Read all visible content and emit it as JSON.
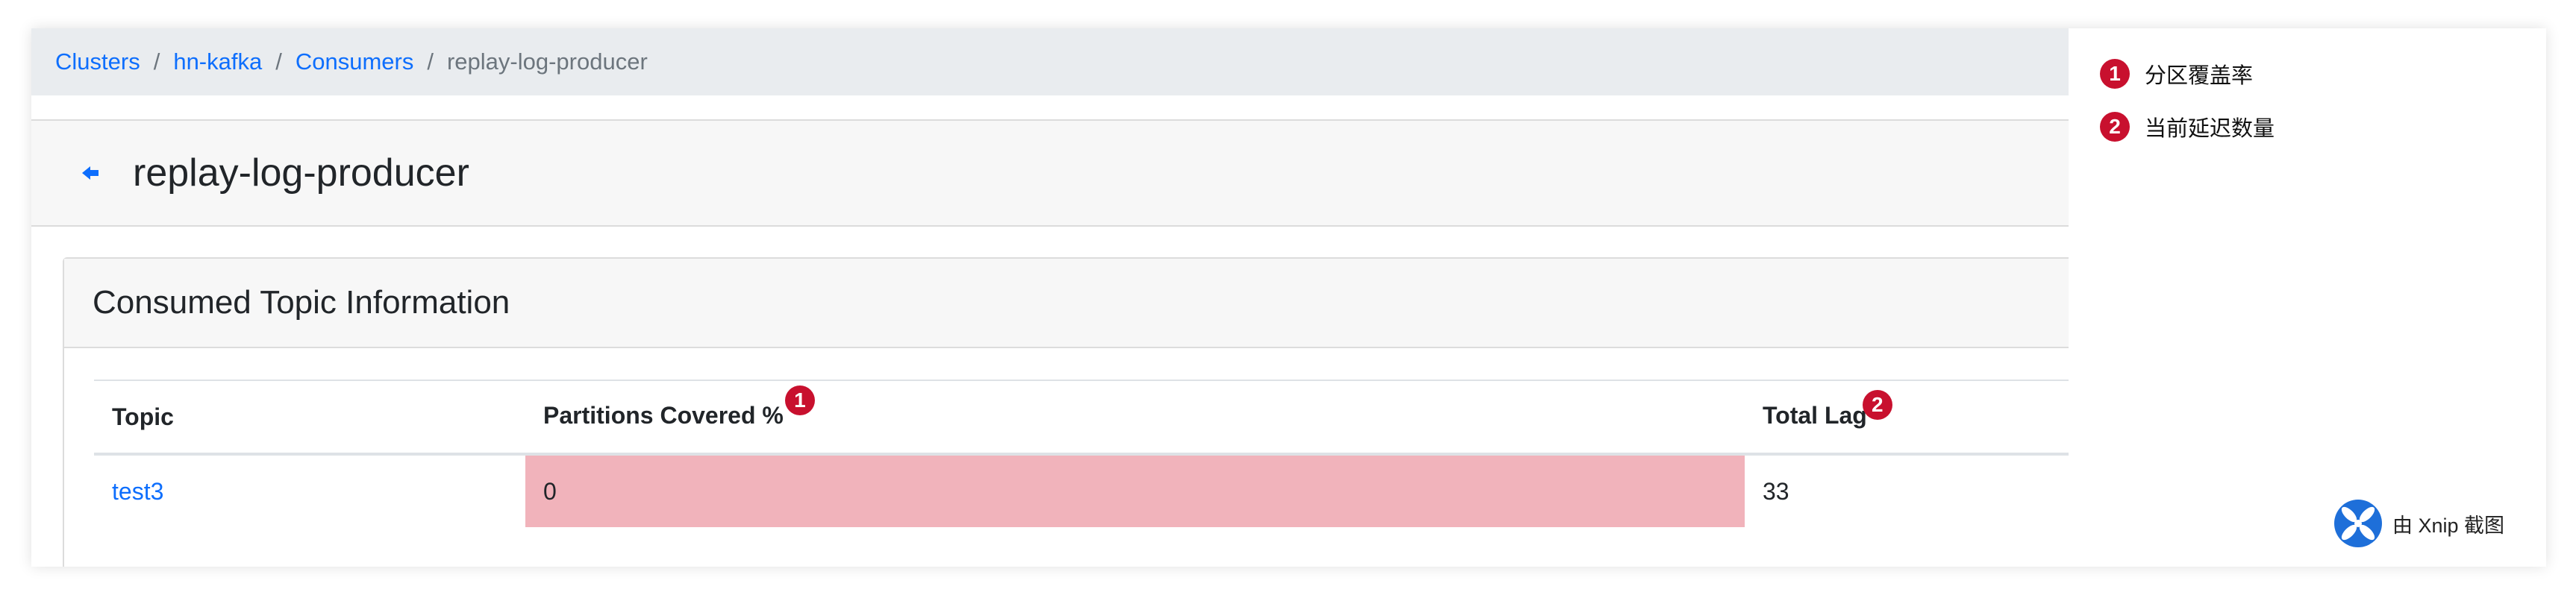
{
  "breadcrumb": {
    "items": [
      "Clusters",
      "hn-kafka",
      "Consumers"
    ],
    "current": "replay-log-producer",
    "separator": "/"
  },
  "page": {
    "title": "replay-log-producer"
  },
  "section": {
    "title": "Consumed Topic Information"
  },
  "table": {
    "headers": {
      "topic": "Topic",
      "partitions": "Partitions Covered %",
      "partitions_marker": "1",
      "lag": "Total Lag",
      "lag_marker": "2"
    },
    "rows": [
      {
        "topic": "test3",
        "partitions_covered": "0",
        "total_lag": "33"
      }
    ]
  },
  "notes": [
    {
      "marker": "1",
      "text": "分区覆盖率"
    },
    {
      "marker": "2",
      "text": "当前延迟数量"
    }
  ],
  "watermark": {
    "text": "由 Xnip 截图"
  },
  "colors": {
    "link": "#0d6efd",
    "marker": "#c8102e",
    "danger_row": "#f1b3bb",
    "breadcrumb_bg": "#e9ecef"
  }
}
